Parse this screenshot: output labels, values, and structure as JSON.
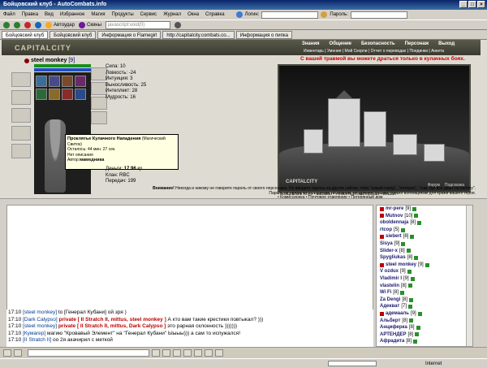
{
  "window": {
    "title": "Бойцовский клуб - AutoCombats.info"
  },
  "menu": {
    "items": [
      "Файл",
      "Правка",
      "Вид",
      "Избранное",
      "Магия",
      "Продукты",
      "Сервис",
      "Журнал",
      "Окна",
      "Справка"
    ],
    "login_label": "Логин:",
    "password_label": "Пароль:"
  },
  "toolbar": {
    "autosave": "Автоудар",
    "skins": "Скины",
    "url": "javascript:void(0)"
  },
  "tabs": [
    {
      "label": "Бойцовский клуб"
    },
    {
      "label": "Бойцовский клуб"
    },
    {
      "label": "Информация о Flamegirl"
    },
    {
      "label": "http://capitalcity.combats.co..."
    },
    {
      "label": "Информация о пипка"
    }
  ],
  "game": {
    "logo": "CAPITALCITY",
    "top_nav": [
      "Знания",
      "Общение",
      "Безопасность",
      "Персонаж",
      "Выход"
    ],
    "sub_nav": "Инвентарь | Умения | Мой Скорпи | Отчет о переводах | Поединки | Анкета",
    "character": {
      "name": "steel monkey",
      "level": "[9]",
      "hp": "526/526",
      "mp": "52/520"
    },
    "stats": [
      "Сила: 10",
      "Ловкость: -24",
      "Интуиция: 3",
      "Выносливость: 25",
      "Интеллект: 28",
      "Мудрость: 16"
    ],
    "tooltip": {
      "title": "Проклятье Кулачного Нападения",
      "subtitle": "(Магический Свиток)",
      "remaining": "Осталось: 44 мин. 27 сек.",
      "description": "Нет описания",
      "author_label": "Автор:",
      "author": "мамедника"
    },
    "money_label": "Деньги:",
    "money": "17.96",
    "money_unit": "кр.",
    "clan": "Клан: RBC",
    "transfers": "Передач: 199",
    "banner": "С вашей травмой вы можете драться только в кулачных боях.",
    "view_logo": "CAPITALCITY",
    "view_links": [
      "Форум",
      "Подсказка"
    ],
    "locations": [
      "• Бойцовский Клуб  • Магазин  • Ремонтная мастерская  • Вокзал",
      "• Комиссионка  • Почтовое отделение  • Потерянный дом"
    ]
  },
  "notice": {
    "heading": "Внимание!",
    "text": "Никогда и никому не говорите пароль от своего персонажа. Не вводите пароль на других сайтах, типа \"новый город\", \"лотерея\", \"там, где все дают на халяву\". Пароль не нужен ни паладинам, ни кланам, ни администрации, только взломщикам для кражи вашего героя."
  },
  "users": [
    {
      "name": "mr-pere",
      "level": "[9]"
    },
    {
      "name": "Mutnov",
      "level": "[10]"
    },
    {
      "name": "oboldennaja",
      "level": "[8]"
    },
    {
      "name": "rtcop",
      "level": "[5]"
    },
    {
      "name": "siebert",
      "level": "[8]"
    },
    {
      "name": "Sisya",
      "level": "[9]"
    },
    {
      "name": "Slider-x",
      "level": "[8]"
    },
    {
      "name": "Spygliukas",
      "level": "[8]"
    },
    {
      "name": "steel monkey",
      "level": "[9]"
    },
    {
      "name": "V ozdux",
      "level": "[9]"
    },
    {
      "name": "Vladimir I",
      "level": "[9]"
    },
    {
      "name": "vlastelin",
      "level": "[8]"
    },
    {
      "name": "Wi Fi",
      "level": "[8]"
    },
    {
      "name": "Za Dengi",
      "level": "[8]"
    },
    {
      "name": "Адекват",
      "level": "[7]"
    },
    {
      "name": "адемааль",
      "level": "[9]"
    },
    {
      "name": "Альберт",
      "level": "[8]"
    },
    {
      "name": "Анциферка",
      "level": "[8]"
    },
    {
      "name": "АРТЕНДЕР",
      "level": "[8]"
    },
    {
      "name": "Афрадита",
      "level": "[8]"
    }
  ],
  "chat": [
    {
      "time": "17:10",
      "nick": "[steel monkey]",
      "priv": "",
      "msg": "to [Генерал Кубани] ой зря )"
    },
    {
      "time": "17:10",
      "nick": "[Dark Calypso]",
      "priv": "private [ II Stratch II, mittus, steel monkey ]",
      "msg": "А кто вам такие крестики повтыкал? )))"
    },
    {
      "time": "17:10",
      "nick": "[steel monkey]",
      "priv": "private [ II Stratch II, mittus, Dark Calypso ]",
      "msg": "это рарная склонность )))))))"
    },
    {
      "time": "17:10",
      "nick": "[Кумагер]",
      "priv": "",
      "msg": "магию \"Кровавый Элемент\" на \"Генерал Кубани\" Ыыыы))) а сам то испужался!"
    },
    {
      "time": "17:10",
      "nick": "[II Stratch II]",
      "priv": "",
      "msg": "оо 2я акачирил с меткой"
    }
  ],
  "status": {
    "zone": "Internet"
  }
}
